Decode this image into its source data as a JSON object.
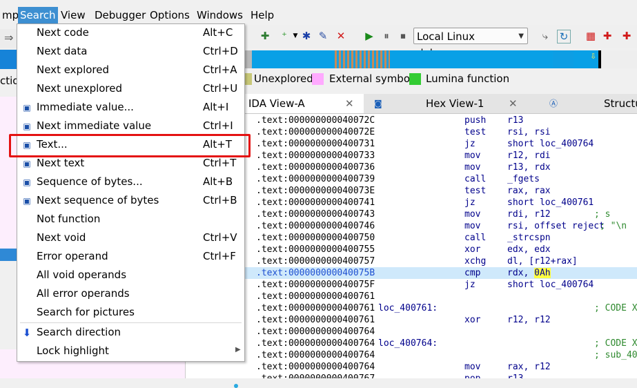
{
  "menubar": {
    "items": [
      {
        "label": "mp"
      },
      {
        "label": "Search"
      },
      {
        "label": "View"
      },
      {
        "label": "Debugger"
      },
      {
        "label": "Options"
      },
      {
        "label": "Windows"
      },
      {
        "label": "Help"
      }
    ]
  },
  "toolbar": {
    "debugger_label": "Local Linux debugger"
  },
  "search_menu": {
    "items": [
      {
        "label": "Next code",
        "shortcut": "Alt+C"
      },
      {
        "label": "Next data",
        "shortcut": "Ctrl+D"
      },
      {
        "label": "Next explored",
        "shortcut": "Ctrl+A"
      },
      {
        "label": "Next unexplored",
        "shortcut": "Ctrl+U"
      },
      {
        "label": "Immediate value...",
        "shortcut": "Alt+I"
      },
      {
        "label": "Next immediate value",
        "shortcut": "Ctrl+I"
      },
      {
        "label": "Text...",
        "shortcut": "Alt+T"
      },
      {
        "label": "Next text",
        "shortcut": "Ctrl+T"
      },
      {
        "label": "Sequence of bytes...",
        "shortcut": "Alt+B"
      },
      {
        "label": "Next sequence of bytes",
        "shortcut": "Ctrl+B"
      },
      {
        "label": "Not function",
        "shortcut": ""
      },
      {
        "label": "Next void",
        "shortcut": "Ctrl+V"
      },
      {
        "label": "Error operand",
        "shortcut": "Ctrl+F"
      },
      {
        "label": "All void operands",
        "shortcut": ""
      },
      {
        "label": "All error operands",
        "shortcut": ""
      },
      {
        "label": "Search for pictures",
        "shortcut": ""
      },
      {
        "label": "Search direction",
        "shortcut": ""
      },
      {
        "label": "Lock highlight",
        "shortcut": ""
      }
    ]
  },
  "left_panel": {
    "partial_label": "ctio"
  },
  "legend": {
    "items": [
      {
        "label": "Unexplored",
        "color": "#c8c878"
      },
      {
        "label": "External symbol",
        "color": "#ffaaff"
      },
      {
        "label": "Lumina function",
        "color": "#33cc33"
      }
    ]
  },
  "tabs": [
    {
      "label": "IDA View-A"
    },
    {
      "label": "Hex View-1"
    },
    {
      "label": "Structu"
    }
  ],
  "disasm": {
    "rows": [
      {
        "addr": ".text:000000000040072C",
        "label": "",
        "mnem": "push",
        "op": "r13",
        "cmt": ""
      },
      {
        "addr": ".text:000000000040072E",
        "label": "",
        "mnem": "test",
        "op": "rsi, rsi",
        "cmt": ""
      },
      {
        "addr": ".text:0000000000400731",
        "label": "",
        "mnem": "jz",
        "op": "short loc_400764",
        "cmt": ""
      },
      {
        "addr": ".text:0000000000400733",
        "label": "",
        "mnem": "mov",
        "op": "r12, rdi",
        "cmt": ""
      },
      {
        "addr": ".text:0000000000400736",
        "label": "",
        "mnem": "mov",
        "op": "r13, rdx",
        "cmt": ""
      },
      {
        "addr": ".text:0000000000400739",
        "label": "",
        "mnem": "call",
        "op": "_fgets",
        "cmt": ""
      },
      {
        "addr": ".text:000000000040073E",
        "label": "",
        "mnem": "test",
        "op": "rax, rax",
        "cmt": ""
      },
      {
        "addr": ".text:0000000000400741",
        "label": "",
        "mnem": "jz",
        "op": "short loc_400761",
        "cmt": ""
      },
      {
        "addr": ".text:0000000000400743",
        "label": "",
        "mnem": "mov",
        "op": "rdi, r12",
        "cmt": "; s"
      },
      {
        "addr": ".text:0000000000400746",
        "label": "",
        "mnem": "mov",
        "op": "rsi, offset reject",
        "cmt": "; \"\\n"
      },
      {
        "addr": ".text:0000000000400750",
        "label": "",
        "mnem": "call",
        "op": "_strcspn",
        "cmt": ""
      },
      {
        "addr": ".text:0000000000400755",
        "label": "",
        "mnem": "xor",
        "op": "edx, edx",
        "cmt": ""
      },
      {
        "addr": ".text:0000000000400757",
        "label": "",
        "mnem": "xchg",
        "op": "dl, [r12+rax]",
        "cmt": ""
      },
      {
        "addr": ".text:000000000040075B",
        "label": "",
        "mnem": "cmp",
        "op_pre": "rdx, ",
        "op_hl": "0Ah",
        "cmt": ""
      },
      {
        "addr": ".text:000000000040075F",
        "label": "",
        "mnem": "jz",
        "op": "short loc_400764",
        "cmt": ""
      },
      {
        "addr": ".text:0000000000400761",
        "label": "",
        "mnem": "",
        "op": "",
        "cmt": ""
      },
      {
        "addr": ".text:0000000000400761",
        "label": "loc_400761:",
        "mnem": "",
        "op": "",
        "cmt": "; CODE X"
      },
      {
        "addr": ".text:0000000000400761",
        "label": "",
        "mnem": "xor",
        "op": "r12, r12",
        "cmt": ""
      },
      {
        "addr": ".text:0000000000400764",
        "label": "",
        "mnem": "",
        "op": "",
        "cmt": ""
      },
      {
        "addr": ".text:0000000000400764",
        "label": "loc_400764:",
        "mnem": "",
        "op": "",
        "cmt": "; CODE X"
      },
      {
        "addr": ".text:0000000000400764",
        "label": "",
        "mnem": "",
        "op": "",
        "cmt": "; sub_40"
      },
      {
        "addr": ".text:0000000000400764",
        "label": "",
        "mnem": "mov",
        "op": "rax, r12",
        "cmt": ""
      },
      {
        "addr": ".text:0000000000400767",
        "label": "",
        "mnem": "pop",
        "op": "r13",
        "cmt": ""
      }
    ]
  },
  "colors": {
    "menu_active": "#3d8fd1",
    "focus_box": "#e41111",
    "nav_band": "#09a0e6",
    "highlight_row": "#cfe9fb",
    "operand_highlight": "#ffff40"
  }
}
